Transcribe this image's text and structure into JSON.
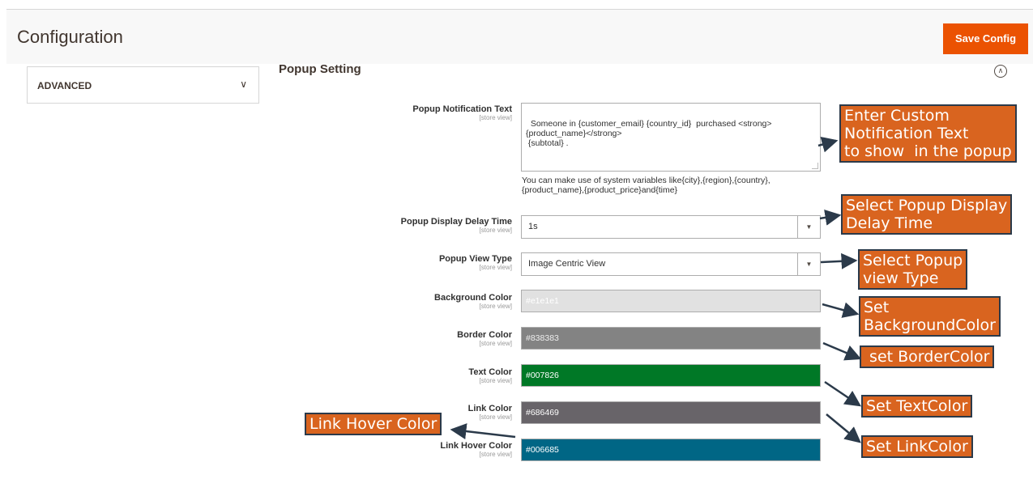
{
  "header": {
    "title": "Configuration",
    "save_label": "Save Config"
  },
  "sidebar": {
    "advanced_label": "ADVANCED"
  },
  "section": {
    "title": "Popup Setting"
  },
  "fields": {
    "notification_text": {
      "label": "Popup Notification Text",
      "scope": "[store view]",
      "value": "Someone in {customer_email} {country_id}  purchased <strong>\n{product_name}</strong>\n {subtotal} .",
      "note": "You can make use of system variables like{city},{region},{country},\n{product_name},{product_price}and{time}"
    },
    "delay_time": {
      "label": "Popup Display Delay Time",
      "scope": "[store view]",
      "value": "1s"
    },
    "view_type": {
      "label": "Popup View Type",
      "scope": "[store view]",
      "value": "Image Centric View"
    },
    "background_color": {
      "label": "Background Color",
      "scope": "[store view]",
      "value": "#e1e1e1",
      "color": "#e1e1e1",
      "text_color": "#ffffff"
    },
    "border_color": {
      "label": "Border Color",
      "scope": "[store view]",
      "value": "#838383",
      "color": "#838383",
      "text_color": "#eeeeee"
    },
    "text_color": {
      "label": "Text Color",
      "scope": "[store view]",
      "value": "#007826",
      "color": "#007826",
      "text_color": "#ffffff"
    },
    "link_color": {
      "label": "Link Color",
      "scope": "[store view]",
      "value": "#686469",
      "color": "#686469",
      "text_color": "#ffffff"
    },
    "link_hover_color": {
      "label": "Link Hover Color",
      "scope": "[store view]",
      "value": "#006685",
      "color": "#006685",
      "text_color": "#ffffff"
    }
  },
  "callouts": {
    "notification": "Enter Custom\nNotification Text\nto show  in the popup",
    "delay": "Select Popup Display\nDelay Time",
    "view_type": "Select Popup\nview Type",
    "background": "Set\nBackgroundColor",
    "border": " set BorderColor",
    "text": "Set TextColor",
    "link": "Set LinkColor",
    "link_hover": "Link Hover Color"
  },
  "colors": {
    "accent": "#eb5202",
    "callout_bg": "#d9641f",
    "callout_border": "#2b3a4a"
  }
}
